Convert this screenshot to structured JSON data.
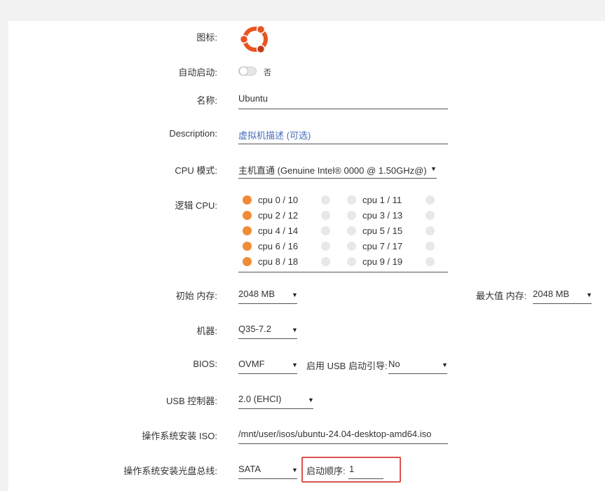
{
  "labels": {
    "icon": "图标:",
    "autostart": "自动启动:",
    "name": "名称:",
    "description": "Description:",
    "cpu_mode": "CPU 模式:",
    "logical_cpu": "逻辑 CPU:",
    "init_memory": "初始 内存:",
    "max_memory": "最大值 内存:",
    "machine": "机器:",
    "bios": "BIOS:",
    "usb_boot": "启用 USB 启动引导:",
    "usb_controller": "USB 控制器:",
    "os_iso": "操作系统安装 ISO:",
    "os_bus": "操作系统安装光盘总线:",
    "boot_order": "启动顺序:"
  },
  "values": {
    "icon_name": "ubuntu-logo-icon",
    "autostart_text": "否",
    "autostart_on": false,
    "name": "Ubuntu",
    "description_placeholder": "虚拟机描述 (可选)",
    "cpu_mode": "主机直通 (Genuine Intel® 0000 @ 1.50GHz@)",
    "init_memory": "2048 MB",
    "max_memory": "2048 MB",
    "machine": "Q35-7.2",
    "bios": "OVMF",
    "usb_boot": "No",
    "usb_controller": "2.0 (EHCI)",
    "os_iso": "/mnt/user/isos/ubuntu-24.04-desktop-amd64.iso",
    "os_bus": "SATA",
    "boot_order": "1"
  },
  "cpus": [
    {
      "label": "cpu 0 / 10",
      "a": true,
      "b": false
    },
    {
      "label": "cpu 1 / 11",
      "a": false,
      "b": false
    },
    {
      "label": "cpu 2 / 12",
      "a": true,
      "b": false
    },
    {
      "label": "cpu 3 / 13",
      "a": false,
      "b": false
    },
    {
      "label": "cpu 4 / 14",
      "a": true,
      "b": false
    },
    {
      "label": "cpu 5 / 15",
      "a": false,
      "b": false
    },
    {
      "label": "cpu 6 / 16",
      "a": true,
      "b": false
    },
    {
      "label": "cpu 7 / 17",
      "a": false,
      "b": false
    },
    {
      "label": "cpu 8 / 18",
      "a": true,
      "b": false
    },
    {
      "label": "cpu 9 / 19",
      "a": false,
      "b": false
    }
  ],
  "colors": {
    "accent": "#f08c38",
    "placeholder": "#486dba",
    "highlight": "#d9534f"
  }
}
